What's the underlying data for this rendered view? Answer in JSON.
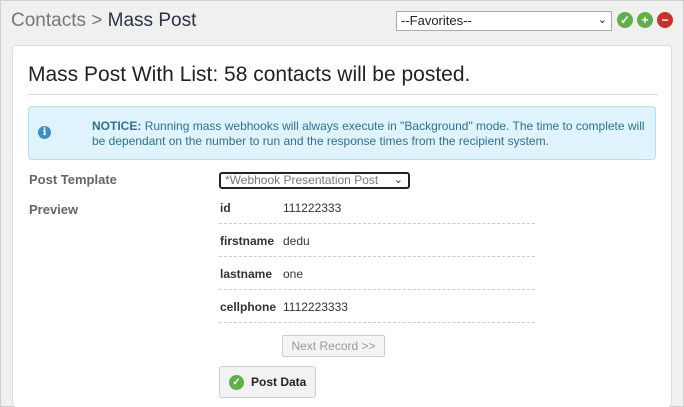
{
  "breadcrumb": {
    "parent": "Contacts",
    "separator": ">",
    "current": "Mass Post"
  },
  "favorites": {
    "selected": "--Favorites--"
  },
  "header_icons": {
    "add_favorite": "check-circle-icon",
    "new_favorite": "plus-circle-icon",
    "remove_favorite": "minus-circle-icon"
  },
  "panel": {
    "title": "Mass Post With List: 58 contacts will be posted.",
    "notice": {
      "icon": "info-icon",
      "label": "NOTICE:",
      "text": "Running mass webhooks will always execute in \"Background\" mode. The time to complete will be dependant on the number to run and the response times from the recipient system."
    },
    "post_template_label": "Post Template",
    "post_template_value": "*Webhook Presentation Post",
    "preview_label": "Preview",
    "preview_rows": [
      {
        "key": "id",
        "value": "111222333"
      },
      {
        "key": "firstname",
        "value": "dedu"
      },
      {
        "key": "lastname",
        "value": "one"
      },
      {
        "key": "cellphone",
        "value": "1112223333"
      }
    ],
    "next_record_label": "Next Record >>",
    "post_data_label": "Post Data"
  },
  "colors": {
    "accent_green": "#5fb04a",
    "danger_red": "#c3352b",
    "notice_bg": "#def3fb",
    "notice_text": "#31708f"
  }
}
